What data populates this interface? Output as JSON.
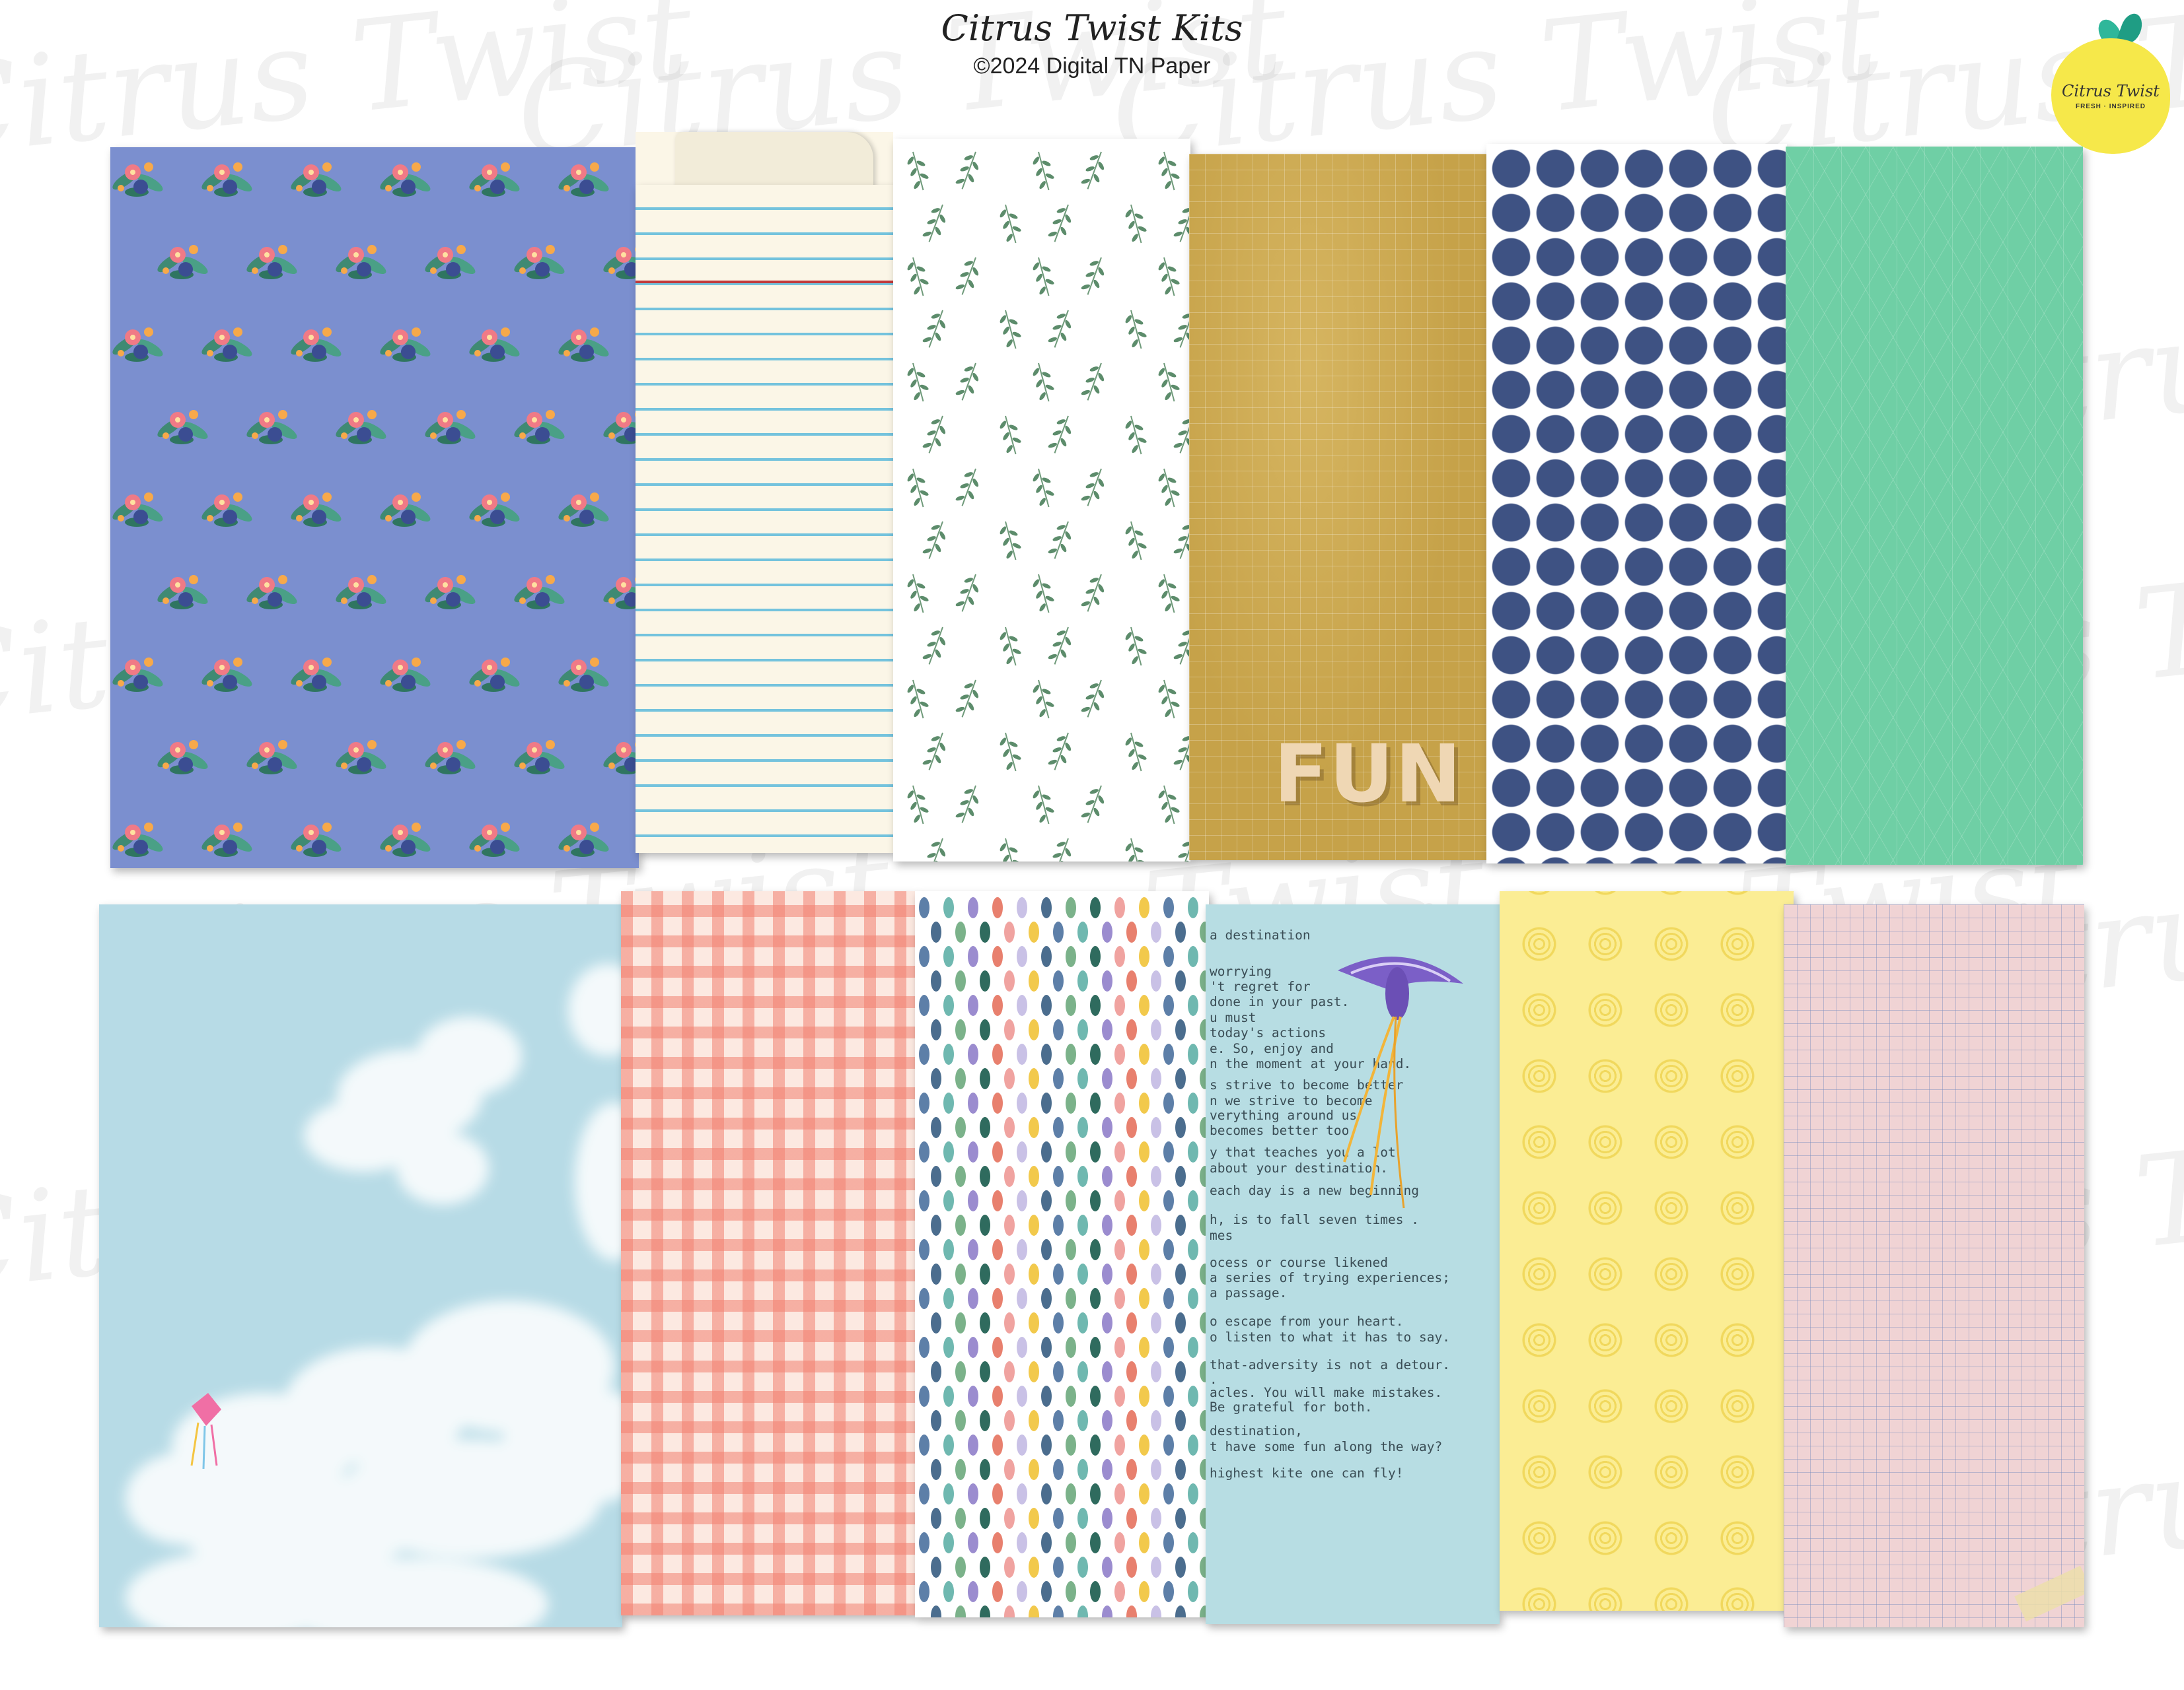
{
  "header": {
    "title": "Citrus Twist Kits",
    "subtitle": "©2024 Digital TN Paper"
  },
  "logo": {
    "name": "Citrus Twist",
    "tagline": "FRESH · INSPIRED"
  },
  "watermark": "Citrus Twist",
  "papers": {
    "fun_label": "FUN",
    "journal_lines": [
      "a destination",
      "worrying",
      "'t regret for",
      "done in your past.",
      "u must",
      "today's actions",
      "e. So, enjoy and",
      "n the moment        at your hand.",
      "s strive to        become better",
      "n we strive       to become",
      "verything            around us",
      "            becomes better too",
      "y that teaches you a lot",
      "        about your destination.",
      "each day is a new beginning",
      "h, is to fall seven times .",
      "mes",
      "ocess or course likened",
      "a series of trying experiences;",
      "                   a passage.",
      "o escape from your heart.",
      "o listen to what it has to say.",
      "that-adversity is not a detour.",
      ".",
      "acles. You will make mistakes.",
      "Be grateful for both.",
      "destination,",
      "t have some fun along the way?",
      "highest kite one can fly!"
    ]
  },
  "colors": {
    "floral_bg": "#7b8fcf",
    "navy_dot": "#3e5283",
    "mint": "#6fcfa5",
    "mustard": "#c6a249",
    "sky": "#b7dbe6",
    "lemon": "#f6e84a"
  }
}
